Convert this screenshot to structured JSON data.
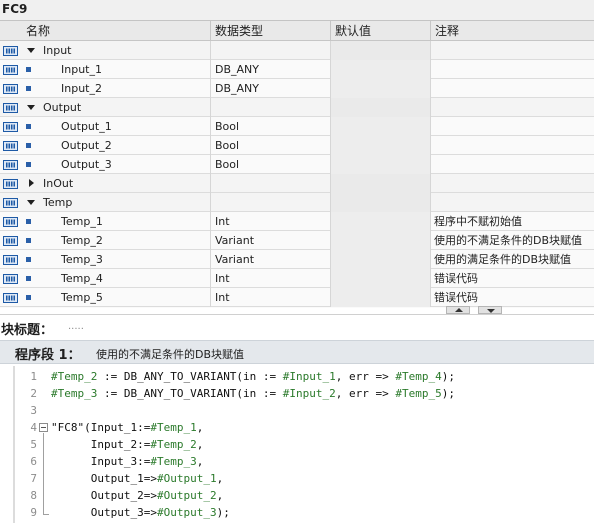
{
  "block": {
    "name": "FC9"
  },
  "table": {
    "headers": {
      "name": "名称",
      "type": "数据类型",
      "default": "默认值",
      "comment": "注释"
    },
    "rows": [
      {
        "kind": "section",
        "expanded": true,
        "name": "Input",
        "type": "",
        "comment": ""
      },
      {
        "kind": "var",
        "name": "Input_1",
        "type": "DB_ANY",
        "comment": ""
      },
      {
        "kind": "var",
        "name": "Input_2",
        "type": "DB_ANY",
        "comment": ""
      },
      {
        "kind": "section",
        "expanded": true,
        "name": "Output",
        "type": "",
        "comment": ""
      },
      {
        "kind": "var",
        "name": "Output_1",
        "type": "Bool",
        "comment": ""
      },
      {
        "kind": "var",
        "name": "Output_2",
        "type": "Bool",
        "comment": ""
      },
      {
        "kind": "var",
        "name": "Output_3",
        "type": "Bool",
        "comment": ""
      },
      {
        "kind": "section",
        "expanded": false,
        "name": "InOut",
        "type": "",
        "comment": ""
      },
      {
        "kind": "section",
        "expanded": true,
        "name": "Temp",
        "type": "",
        "comment": ""
      },
      {
        "kind": "var",
        "name": "Temp_1",
        "type": "Int",
        "comment": "程序中不赋初始值"
      },
      {
        "kind": "var",
        "name": "Temp_2",
        "type": "Variant",
        "comment": "使用的不满足条件的DB块赋值"
      },
      {
        "kind": "var",
        "name": "Temp_3",
        "type": "Variant",
        "comment": "使用的满足条件的DB块赋值"
      },
      {
        "kind": "var",
        "name": "Temp_4",
        "type": "Int",
        "comment": "错误代码"
      },
      {
        "kind": "var",
        "name": "Temp_5",
        "type": "Int",
        "comment": "错误代码"
      }
    ]
  },
  "block_title": {
    "label": "块标题：",
    "value": "....."
  },
  "network": {
    "label": "程序段 1：",
    "title": "使用的不满足条件的DB块赋值"
  },
  "code": {
    "lines": [
      {
        "n": "1",
        "text": "#Temp_2 := DB_ANY_TO_VARIANT(in := #Input_1, err => #Temp_4);"
      },
      {
        "n": "2",
        "text": "#Temp_3 := DB_ANY_TO_VARIANT(in := #Input_2, err => #Temp_5);"
      },
      {
        "n": "3",
        "text": ""
      },
      {
        "n": "4",
        "text": "\"FC8\"(Input_1:=#Temp_1,"
      },
      {
        "n": "5",
        "text": "      Input_2:=#Temp_2,"
      },
      {
        "n": "6",
        "text": "      Input_3:=#Temp_3,"
      },
      {
        "n": "7",
        "text": "      Output_1=>#Output_1,"
      },
      {
        "n": "8",
        "text": "      Output_2=>#Output_2,"
      },
      {
        "n": "9",
        "text": "      Output_3=>#Output_3);"
      }
    ]
  },
  "icons": {
    "interface_icon": "interface-param-icon",
    "expand": "expand-triangle-icon",
    "collapse": "collapsed-triangle-icon",
    "variable": "variable-square-icon",
    "fold": "fold-minus-icon",
    "scroll_up": "scroll-up-icon",
    "scroll_down": "scroll-down-icon"
  },
  "colors": {
    "variable_square": "#2a5fa8",
    "icon_blue": "#1e5aa6",
    "code_variable": "#2b7a2b",
    "network_bar": "#e4e8ec"
  }
}
